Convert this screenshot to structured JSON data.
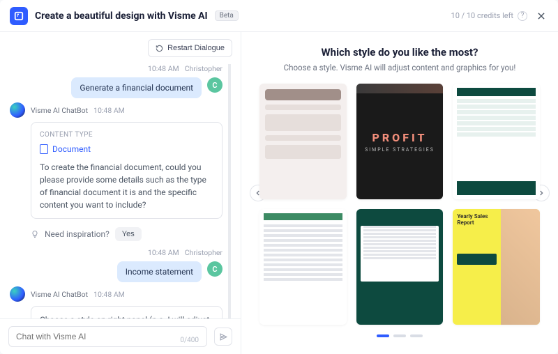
{
  "header": {
    "title": "Create a beautiful design with Visme AI",
    "badge": "Beta",
    "credits": "10 / 10 credits left"
  },
  "toolbar": {
    "restart": "Restart Dialogue"
  },
  "chat": {
    "user_name": "Christopher",
    "user_initial": "C",
    "bot_name": "Visme AI ChatBot",
    "t1": "10:48 AM",
    "msg1": "Generate a financial document",
    "content_type_label": "CONTENT TYPE",
    "content_type_value": "Document",
    "bot_msg1": "To create the financial document, could you please provide some details such as the type of financial document it is and the specific content you want to include?",
    "inspiration": "Need inspiration?",
    "yes": "Yes",
    "msg2": "Income statement",
    "bot_msg2": "Choose a style on right panel (p.s. I will adjust all the content and graphics for you!)"
  },
  "input": {
    "placeholder": "Chat with Visme AI",
    "counter": "0/400"
  },
  "rightPane": {
    "title": "Which style do you like the most?",
    "subtitle": "Choose a style. Visme AI will adjust content and graphics for you!",
    "thumb2_title": "PROFIT",
    "thumb2_sub": "SIMPLE STRATEGIES",
    "thumb6_title": "Yearly Sales Report"
  }
}
